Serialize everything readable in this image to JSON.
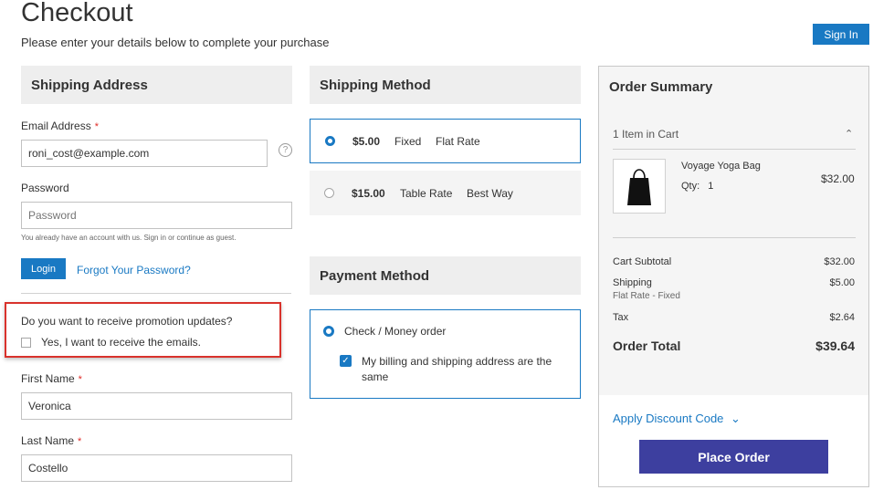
{
  "page": {
    "title": "Checkout",
    "subtitle": "Please enter your details below to complete your purchase",
    "sign_in": "Sign In"
  },
  "shipping_address": {
    "heading": "Shipping Address",
    "email_label": "Email Address",
    "required_mark": "*",
    "email_value": "roni_cost@example.com",
    "help_icon": "?",
    "password_label": "Password",
    "password_placeholder": "Password",
    "account_note": "You already have an account with us. Sign in or continue as guest.",
    "login_button": "Login",
    "forgot_link": "Forgot Your Password?",
    "promo_question": "Do you want to receive promotion updates?",
    "promo_option": "Yes, I want to receive the emails.",
    "promo_checked": false,
    "first_name_label": "First Name",
    "first_name_value": "Veronica",
    "last_name_label": "Last Name",
    "last_name_value": "Costello"
  },
  "shipping_method": {
    "heading": "Shipping Method",
    "options": [
      {
        "price": "$5.00",
        "carrier": "Fixed",
        "method": "Flat Rate",
        "selected": true
      },
      {
        "price": "$15.00",
        "carrier": "Table Rate",
        "method": "Best Way",
        "selected": false
      }
    ]
  },
  "payment_method": {
    "heading": "Payment Method",
    "option": "Check / Money order",
    "same_address": "My billing and shipping address are the same",
    "check_mark": "✓"
  },
  "order_summary": {
    "heading": "Order Summary",
    "items_in_cart": "1 Item in Cart",
    "collapse_icon": "⌃",
    "product": {
      "name": "Voyage Yoga Bag",
      "qty_label": "Qty:",
      "qty": "1",
      "price": "$32.00"
    },
    "totals": {
      "subtotal_label": "Cart Subtotal",
      "subtotal": "$32.00",
      "shipping_label": "Shipping",
      "shipping_method": "Flat Rate - Fixed",
      "shipping": "$5.00",
      "tax_label": "Tax",
      "tax": "$2.64",
      "order_total_label": "Order Total",
      "order_total": "$39.64"
    },
    "discount_link": "Apply Discount Code",
    "discount_chevron": "⌄",
    "place_order": "Place Order"
  },
  "colors": {
    "accent": "#1979c3",
    "place_order": "#3d3f9f",
    "highlight_border": "#d9322c",
    "required": "#e02b27"
  }
}
